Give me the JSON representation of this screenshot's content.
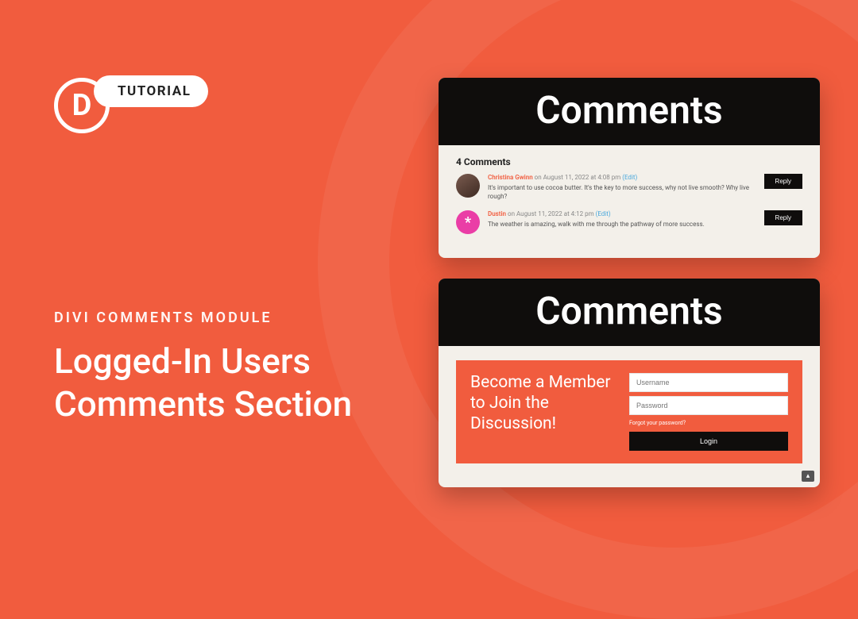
{
  "badge": {
    "letter": "D",
    "label": "TUTORIAL"
  },
  "kicker": "DIVI COMMENTS MODULE",
  "headline": "Logged-In Users Comments Section",
  "cards": {
    "header_title": "Comments",
    "comments_count": "4 Comments",
    "comments": [
      {
        "author": "Christina Gwinn",
        "date": "on August 11, 2022 at 4:08 pm",
        "edit": "(Edit)",
        "text": "It's important to use cocoa butter. It's the key to more success, why not live smooth? Why live rough?",
        "reply": "Reply"
      },
      {
        "author": "Dustin",
        "date": "on August 11, 2022 at 4:12 pm",
        "edit": "(Edit)",
        "text": "The weather is amazing, walk with me through the pathway of more success.",
        "reply": "Reply"
      }
    ],
    "login": {
      "cta": "Become a Member to Join the Discussion!",
      "username_placeholder": "Username",
      "password_placeholder": "Password",
      "forgot": "Forgot your password?",
      "button": "Login"
    }
  },
  "scroll_top": "▴"
}
